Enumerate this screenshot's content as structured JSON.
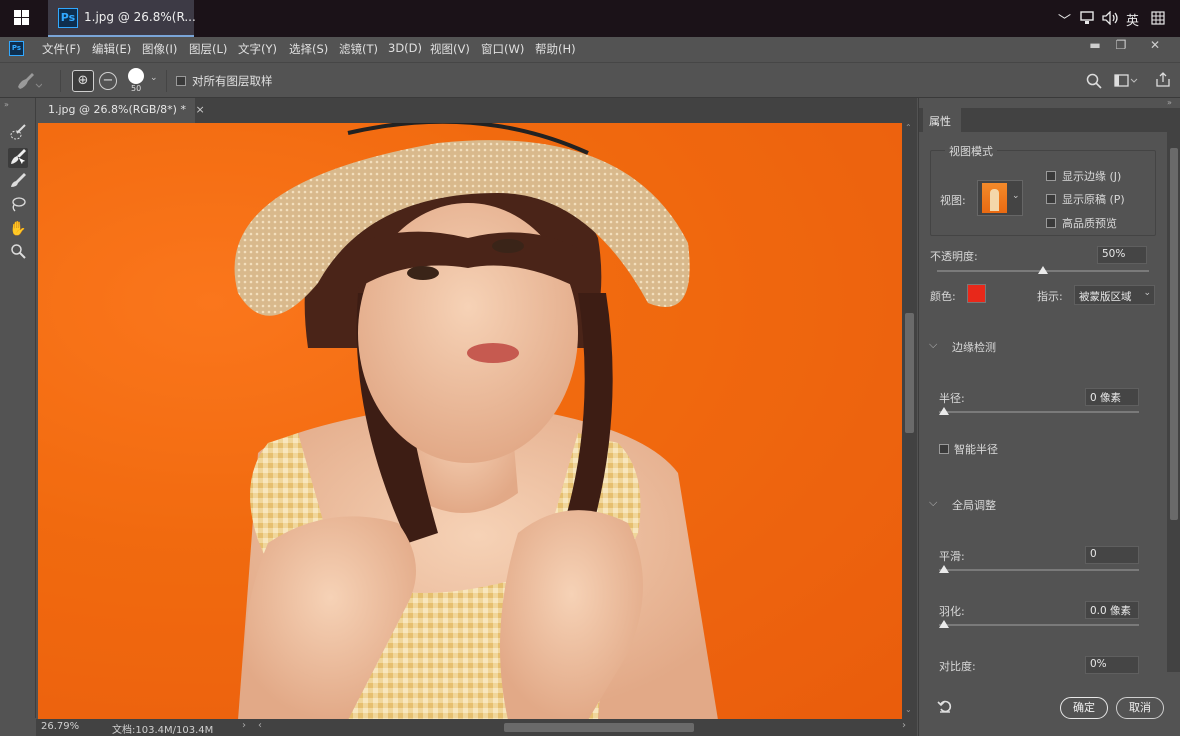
{
  "taskbar": {
    "tab_title": "1.jpg @ 26.8%(R...",
    "ps_label": "Ps",
    "ime": "英"
  },
  "menu": [
    "文件(F)",
    "编辑(E)",
    "图像(I)",
    "图层(L)",
    "文字(Y)",
    "选择(S)",
    "滤镜(T)",
    "3D(D)",
    "视图(V)",
    "窗口(W)",
    "帮助(H)"
  ],
  "options": {
    "brush_size": "50",
    "sample_all_layers": "对所有图层取样"
  },
  "document": {
    "tab_label": "1.jpg @ 26.8%(RGB/8*) *",
    "close": "×"
  },
  "status": {
    "zoom": "26.79%",
    "doc_info": "文档:103.4M/103.4M"
  },
  "panel": {
    "tab": "属性",
    "view_mode": {
      "title": "视图模式",
      "view_label": "视图:",
      "show_edge": "显示边缘 (J)",
      "show_original": "显示原稿 (P)",
      "hq_preview": "高品质预览"
    },
    "opacity": {
      "label": "不透明度:",
      "value": "50%",
      "fraction": 0.5
    },
    "color": {
      "label": "颜色:",
      "swatch": "#e8281a",
      "indicates_label": "指示:",
      "indicates_value": "被蒙版区域"
    },
    "edge_detection": {
      "title": "边缘检测",
      "radius_label": "半径:",
      "radius_value": "0 像素",
      "smart_radius": "智能半径"
    },
    "global_refine": {
      "title": "全局调整",
      "smooth_label": "平滑:",
      "smooth_value": "0",
      "feather_label": "羽化:",
      "feather_value": "0.0 像素",
      "contrast_label": "对比度:",
      "contrast_value": "0%"
    },
    "ok": "确定",
    "cancel": "取消"
  }
}
